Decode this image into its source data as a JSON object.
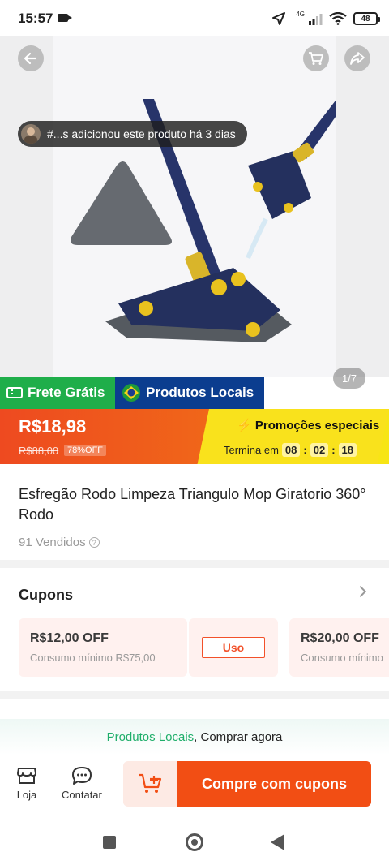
{
  "status_bar": {
    "time": "15:57",
    "network": "4G",
    "battery": "48"
  },
  "hero": {
    "notice_text": "#...s adicionou este produto há 3 dias",
    "page_indicator": "1/7",
    "icons": [
      "back-arrow-icon",
      "cart-icon",
      "share-icon"
    ]
  },
  "badges": {
    "free_shipping": "Frete Grátis",
    "local_products": "Produtos Locais"
  },
  "price": {
    "current": "R$18,98",
    "original": "R$88,00",
    "discount": "78%OFF",
    "promo_title": "Promoções especiais",
    "ends_label": "Termina em",
    "countdown": {
      "hours": "08",
      "minutes": "02",
      "seconds": "18"
    }
  },
  "product": {
    "title": "Esfregão Rodo Limpeza Triangulo Mop Giratorio 360° Rodo",
    "sold": "91 Vendidos"
  },
  "coupons": {
    "heading": "Cupons",
    "items": [
      {
        "value": "R$12,00 OFF",
        "min": "Consumo mínimo R$75,00"
      },
      {
        "value": "R$20,00 OFF",
        "min": "Consumo mínimo"
      }
    ],
    "use_label": "Uso"
  },
  "local_strip": {
    "highlight": "Produtos Locais",
    "rest": ", Comprar agora"
  },
  "action_bar": {
    "store_label": "Loja",
    "contact_label": "Contatar",
    "buy_label": "Compre com cupons"
  },
  "colors": {
    "accent": "#f24e14",
    "green": "#1fae4a",
    "blue": "#0b3d8f",
    "promo_yellow": "#f9e21c"
  }
}
